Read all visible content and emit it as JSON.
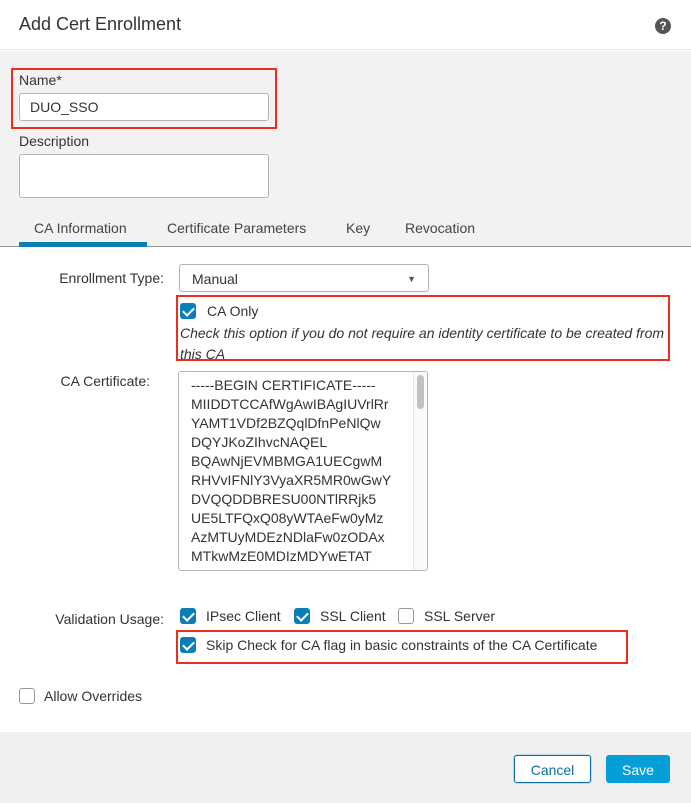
{
  "dialog": {
    "title": "Add Cert Enrollment",
    "help_icon": "?"
  },
  "name_field": {
    "label": "Name*",
    "value": "DUO_SSO"
  },
  "description_field": {
    "label": "Description",
    "value": ""
  },
  "tabs": [
    {
      "label": "CA Information",
      "active": true
    },
    {
      "label": "Certificate Parameters",
      "active": false
    },
    {
      "label": "Key",
      "active": false
    },
    {
      "label": "Revocation",
      "active": false
    }
  ],
  "ca_info": {
    "enrollment_type_label": "Enrollment Type:",
    "enrollment_type_value": "Manual",
    "ca_only": {
      "label": "CA Only",
      "checked": true,
      "hint": "Check this option if you do not require an identity certificate to be created from this CA"
    },
    "ca_certificate_label": "CA Certificate:",
    "ca_certificate_lines": [
      "-----BEGIN CERTIFICATE-----",
      "MIIDDTCCAfWgAwIBAgIUVrlRr",
      "YAMT1VDf2BZQqlDfnPeNlQw",
      "DQYJKoZIhvcNAQEL",
      "BQAwNjEVMBMGA1UECgwM",
      "RHVvIFNlY3VyaXR5MR0wGwY",
      "DVQQDDBRESU00NTlRRjk5",
      "UE5LTFQxQ08yWTAeFw0yMz",
      "AzMTUyMDEzNDlaFw0zODAx",
      "MTkwMzE0MDIzMDYwETAT"
    ],
    "validation_usage_label": "Validation Usage:",
    "validation_usage": [
      {
        "label": "IPsec Client",
        "checked": true
      },
      {
        "label": "SSL Client",
        "checked": true
      },
      {
        "label": "SSL Server",
        "checked": false
      }
    ],
    "skip_check": {
      "label": "Skip Check for CA flag in basic constraints of the CA Certificate",
      "checked": true
    }
  },
  "allow_overrides": {
    "label": "Allow Overrides",
    "checked": false
  },
  "footer": {
    "cancel_label": "Cancel",
    "save_label": "Save"
  },
  "colors": {
    "accent": "#0a7fb5",
    "primary_button": "#049fd9",
    "highlight_box": "#e8301c"
  }
}
